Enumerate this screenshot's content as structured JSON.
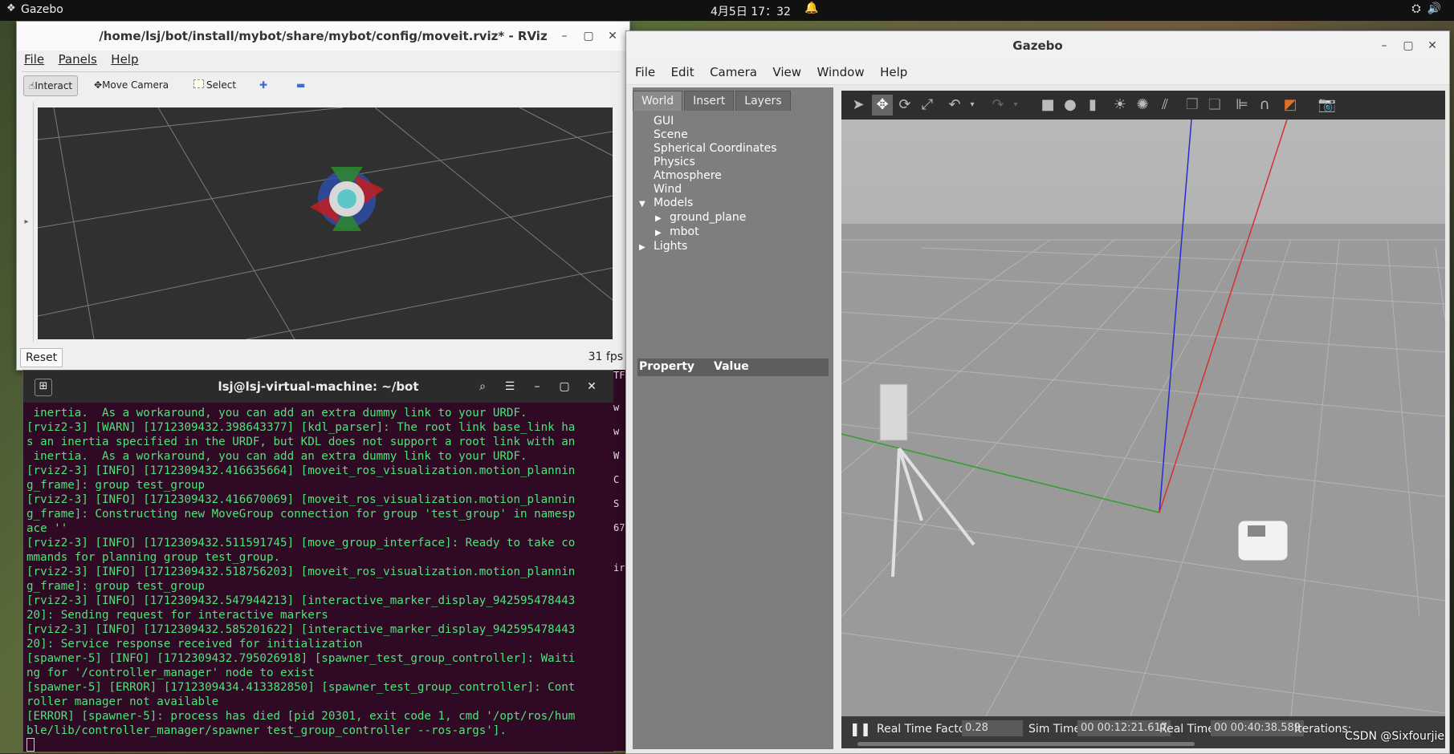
{
  "topbar": {
    "app": "Gazebo",
    "clock": "4月5日  17：32"
  },
  "rviz": {
    "title": "/home/lsj/bot/install/mybot/share/mybot/config/moveit.rviz* - RViz",
    "menu": [
      "File",
      "Panels",
      "Help"
    ],
    "tools": {
      "interact": "Interact",
      "move_camera": "Move Camera",
      "select": "Select",
      "plus": "✚",
      "minus": "▬"
    },
    "reset": "Reset",
    "fps": "31 fps"
  },
  "terminal": {
    "title": "lsj@lsj-virtual-machine: ~/bot",
    "lines": [
      " inertia.  As a workaround, you can add an extra dummy link to your URDF.",
      "[rviz2-3] [WARN] [1712309432.398643377] [kdl_parser]: The root link base_link ha",
      "s an inertia specified in the URDF, but KDL does not support a root link with an",
      " inertia.  As a workaround, you can add an extra dummy link to your URDF.",
      "[rviz2-3] [INFO] [1712309432.416635664] [moveit_ros_visualization.motion_plannin",
      "g_frame]: group test_group",
      "[rviz2-3] [INFO] [1712309432.416670069] [moveit_ros_visualization.motion_plannin",
      "g_frame]: Constructing new MoveGroup connection for group 'test_group' in namesp",
      "ace ''",
      "[rviz2-3] [INFO] [1712309432.511591745] [move_group_interface]: Ready to take co",
      "mmands for planning group test_group.",
      "[rviz2-3] [INFO] [1712309432.518756203] [moveit_ros_visualization.motion_plannin",
      "g_frame]: group test_group",
      "[rviz2-3] [INFO] [1712309432.547944213] [interactive_marker_display_942595478443",
      "20]: Sending request for interactive markers",
      "[rviz2-3] [INFO] [1712309432.585201622] [interactive_marker_display_942595478443",
      "20]: Service response received for initialization",
      "[spawner-5] [INFO] [1712309432.795026918] [spawner_test_group_controller]: Waiti",
      "ng for '/controller_manager' node to exist",
      "[spawner-5] [ERROR] [1712309434.413382850] [spawner_test_group_controller]: Cont",
      "roller manager not available",
      "[ERROR] [spawner-5]: process has died [pid 20301, exit code 1, cmd '/opt/ros/hum",
      "ble/lib/controller_manager/spawner test_group_controller --ros-args']."
    ],
    "side": [
      "TF",
      "w",
      "w",
      "W",
      "C",
      "S",
      "67",
      "ir"
    ]
  },
  "gazebo": {
    "title": "Gazebo",
    "menu": [
      "File",
      "Edit",
      "Camera",
      "View",
      "Window",
      "Help"
    ],
    "tabs": [
      "World",
      "Insert",
      "Layers"
    ],
    "tree": {
      "gui": "GUI",
      "scene": "Scene",
      "spherical": "Spherical Coordinates",
      "physics": "Physics",
      "atmosphere": "Atmosphere",
      "wind": "Wind",
      "models": "Models",
      "ground_plane": "ground_plane",
      "mbot": "mbot",
      "lights": "Lights"
    },
    "props": {
      "property": "Property",
      "value": "Value"
    },
    "status": {
      "rtf_label": "Real Time Factor:",
      "rtf": "0.28",
      "sim_label": "Sim Time:",
      "sim": "00 00:12:21.617",
      "real_label": "Real Time:",
      "real": "00 00:40:38.589",
      "iter_label": "Iterations:"
    }
  },
  "watermark": "CSDN @Sixfourjie"
}
